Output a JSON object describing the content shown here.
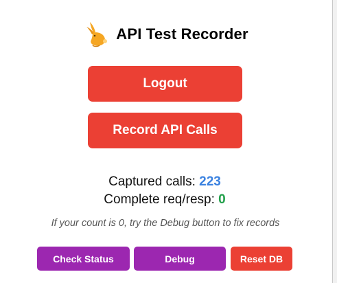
{
  "header": {
    "title": "API Test Recorder",
    "logo_icon": "rabbit-icon",
    "logo_color": "#f5a623"
  },
  "actions": {
    "logout_label": "Logout",
    "record_label": "Record API Calls"
  },
  "stats": {
    "captured_label": "Captured calls:",
    "captured_value": "223",
    "complete_label": "Complete req/resp:",
    "complete_value": "0"
  },
  "hint": "If your count is 0, try the Debug button to fix records",
  "toolbar": {
    "check_status_label": "Check Status",
    "debug_label": "Debug",
    "reset_db_label": "Reset DB"
  },
  "colors": {
    "primary": "#eb4034",
    "secondary": "#9c27b0",
    "count_blue": "#3b82e0",
    "count_green": "#22a04b"
  }
}
